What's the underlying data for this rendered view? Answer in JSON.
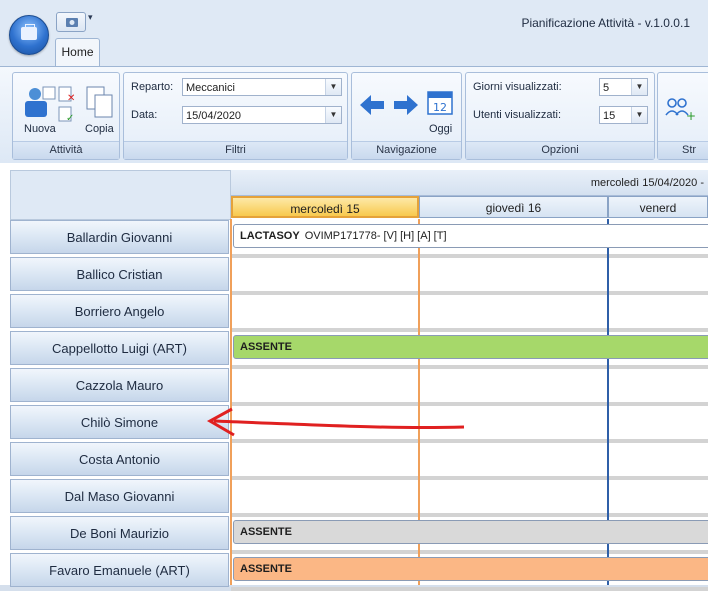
{
  "window": {
    "title": "Pianificazione Attività - v.1.0.0.1"
  },
  "tabs": [
    {
      "label": "Home"
    }
  ],
  "ribbon": {
    "attivita": {
      "label": "Attività",
      "nuova": "Nuova",
      "copia": "Copia"
    },
    "filtri": {
      "label": "Filtri",
      "reparto_label": "Reparto:",
      "reparto_value": "Meccanici",
      "data_label": "Data:",
      "data_value": "15/04/2020"
    },
    "navigazione": {
      "label": "Navigazione",
      "oggi": "Oggi",
      "calendar_day": "12"
    },
    "opzioni": {
      "label": "Opzioni",
      "giorni_label": "Giorni visualizzati:",
      "giorni_value": "5",
      "utenti_label": "Utenti visualizzati:",
      "utenti_value": "15"
    },
    "str": {
      "label": "Str"
    }
  },
  "schedule": {
    "week_header": "mercoledì 15/04/2020 -",
    "days": [
      {
        "label": "mercoledì 15",
        "selected": true
      },
      {
        "label": "giovedì 16",
        "selected": false
      },
      {
        "label": "venerd",
        "selected": false
      }
    ],
    "people": [
      "Ballardin Giovanni",
      "Ballico Cristian",
      "Borriero Angelo",
      "Cappellotto Luigi (ART)",
      "Cazzola Mauro",
      "Chilò Simone",
      "Costa Antonio",
      "Dal Maso Giovanni",
      "De Boni Maurizio",
      "Favaro Emanuele (ART)"
    ],
    "events": [
      {
        "row": 0,
        "title": "LACTASOY",
        "detail": "OVIMP171778- [V] [H] [A] [T]",
        "color": "#ffffff"
      },
      {
        "row": 3,
        "title": "ASSENTE",
        "detail": "",
        "color": "#a6d86a"
      },
      {
        "row": 8,
        "title": "ASSENTE",
        "detail": "",
        "color": "#d9d9d9"
      },
      {
        "row": 9,
        "title": "ASSENTE",
        "detail": "",
        "color": "#fbb785"
      }
    ]
  },
  "colors": {
    "accent": "#2f72cf",
    "annotation_arrow": "#e02020",
    "today_header": "#f8c94e"
  }
}
